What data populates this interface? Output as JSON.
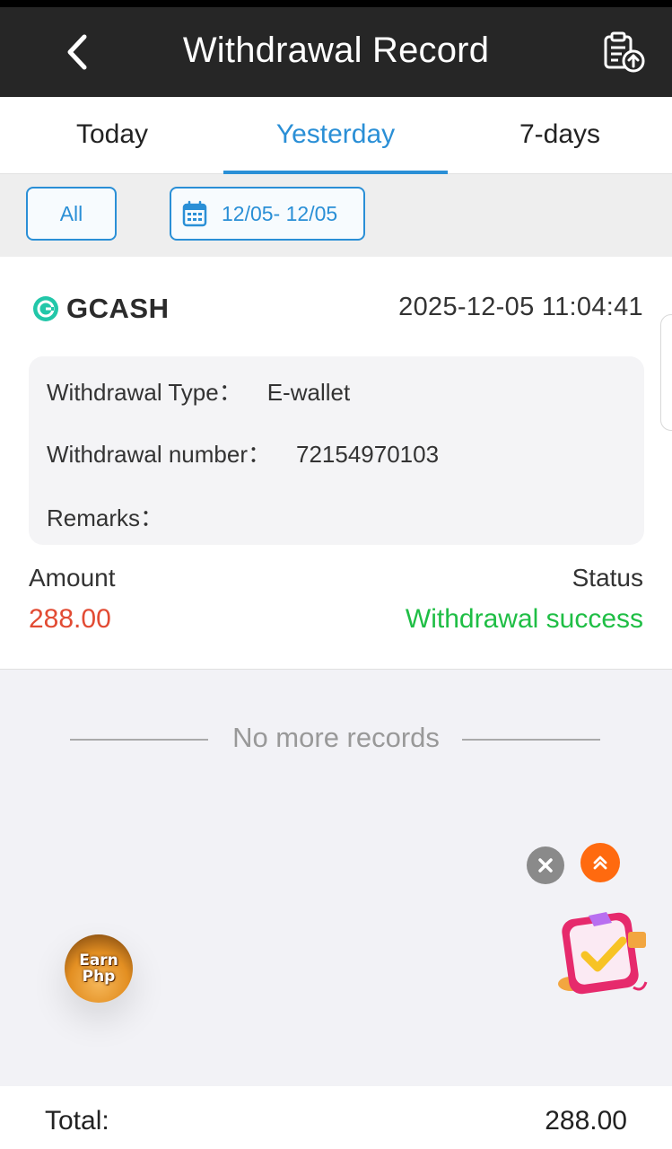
{
  "header": {
    "title": "Withdrawal Record",
    "back_icon": "chevron-left-icon",
    "export_icon": "clipboard-upload-icon"
  },
  "tabs": [
    {
      "label": "Today",
      "active": false
    },
    {
      "label": "Yesterday",
      "active": true
    },
    {
      "label": "7-days",
      "active": false
    }
  ],
  "filters": {
    "type_label": "All",
    "date_range": "12/05- 12/05",
    "date_icon": "calendar-icon"
  },
  "record": {
    "channel": "GCASH",
    "channel_icon": "gcash-logo-icon",
    "time": "2025-12-05 11:04:41",
    "type_label": "Withdrawal Type：",
    "type_value": "E-wallet",
    "number_label": "Withdrawal number：",
    "number_value": "72154970103",
    "remarks_label": "Remarks：",
    "remarks_value": "",
    "amount_label": "Amount",
    "amount_value": "288.00",
    "status_label": "Status",
    "status_value": "Withdrawal success"
  },
  "list_end_text": "No more records",
  "floating": {
    "earn_line1": "Earn",
    "earn_line2": "Php",
    "close_icon": "close-icon",
    "scroll_top_icon": "double-chevron-up-icon",
    "task_icon": "task-gift-icon"
  },
  "footer": {
    "total_label": "Total:",
    "total_value": "288.00"
  },
  "colors": {
    "accent": "#2a8fd6",
    "amount": "#e24b33",
    "success": "#1fbe45",
    "header_bg": "#262626"
  }
}
